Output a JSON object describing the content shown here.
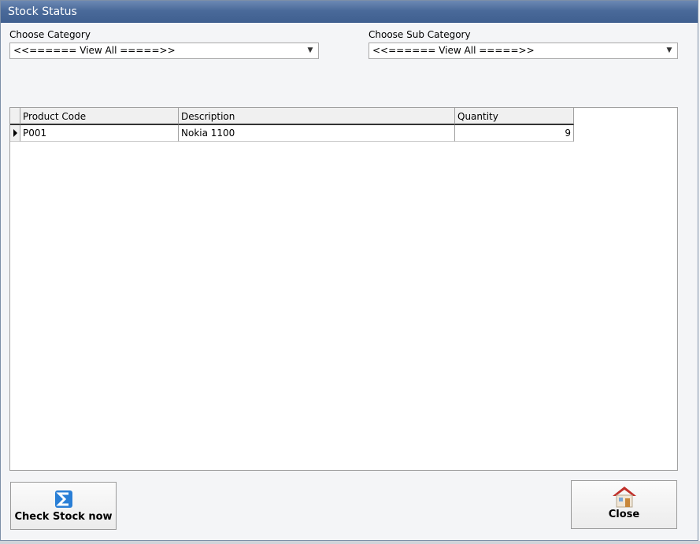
{
  "window": {
    "title": "Stock Status"
  },
  "filters": {
    "category_label": "Choose Category",
    "category_value": "<<====== View All =====>>",
    "subcategory_label": "Choose Sub Category",
    "subcategory_value": "<<====== View All =====>>"
  },
  "grid": {
    "columns": [
      "Product Code",
      "Description",
      "Quantity"
    ],
    "rows": [
      {
        "code": "P001",
        "description": "Nokia 1100",
        "quantity": "9"
      }
    ]
  },
  "buttons": {
    "check_stock": "Check Stock now",
    "close": "Close"
  },
  "icons": {
    "check_stock": "sigma-icon",
    "close": "home-icon"
  }
}
